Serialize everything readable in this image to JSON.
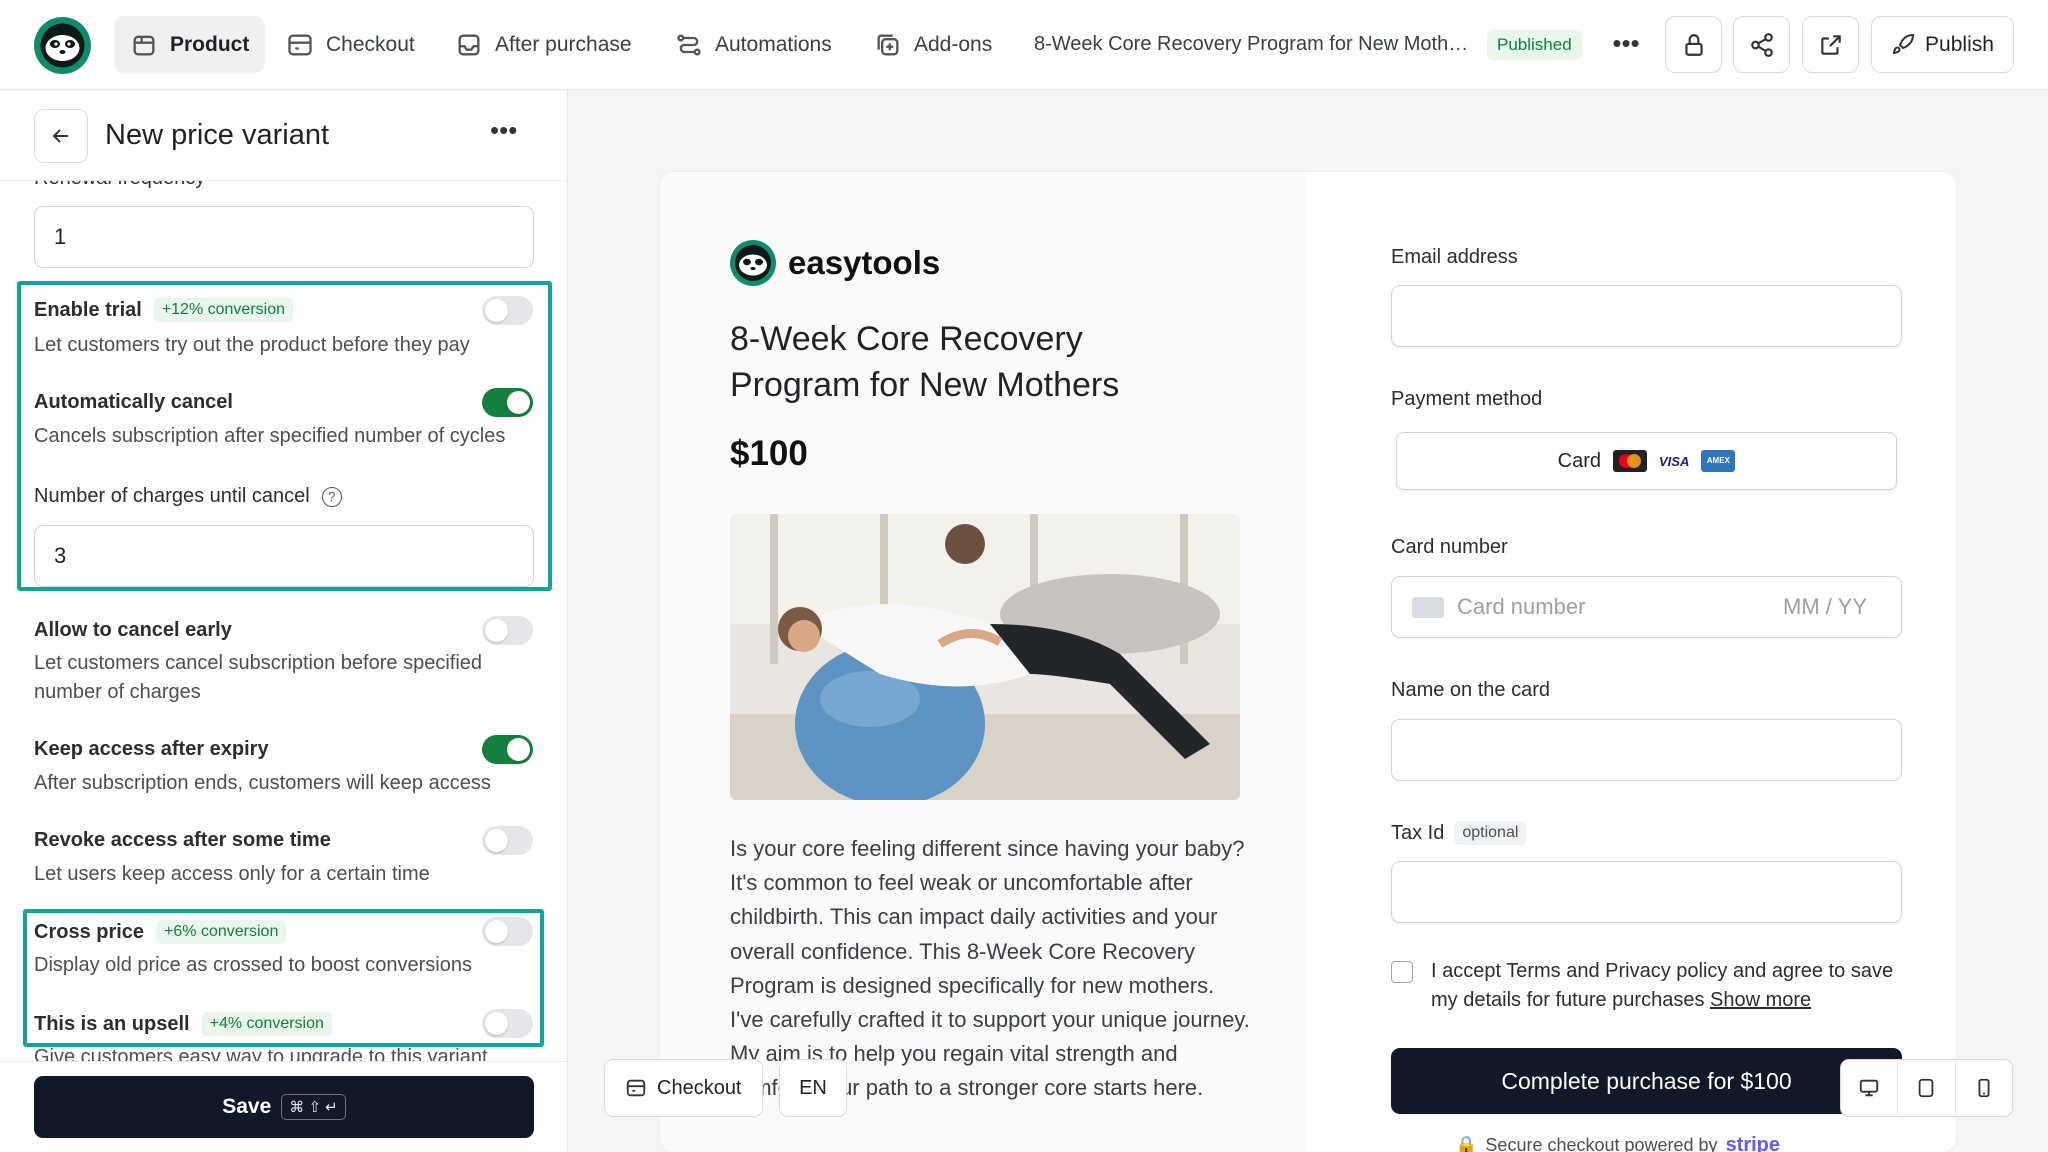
{
  "topbar": {
    "tabs": [
      {
        "label": "Product",
        "icon": "box-icon",
        "active": true
      },
      {
        "label": "Checkout",
        "icon": "checkout-icon",
        "active": false
      },
      {
        "label": "After purchase",
        "icon": "inbox-icon",
        "active": false
      },
      {
        "label": "Automations",
        "icon": "route-icon",
        "active": false
      },
      {
        "label": "Add-ons",
        "icon": "plus-square-icon",
        "active": false
      }
    ],
    "product_title": "8-Week Core Recovery Program for New Moth…",
    "status_badge": "Published",
    "more": "•••",
    "publish_label": "Publish"
  },
  "panel": {
    "title": "New price variant",
    "more": "•••",
    "clipped_label": "Renewal frequency",
    "renewal_value": "1",
    "options": [
      {
        "title": "Enable trial",
        "badge": "+12% conversion",
        "desc": "Let customers try out the product before they pay",
        "on": false
      },
      {
        "title": "Automatically cancel",
        "desc": "Cancels subscription after specified number of cycles",
        "on": true
      },
      {
        "title": "Allow to cancel early",
        "desc": "Let customers cancel subscription before specified number of charges",
        "on": false
      },
      {
        "title": "Keep access after expiry",
        "desc": "After subscription ends, customers will keep access",
        "on": true
      },
      {
        "title": "Revoke access after some time",
        "desc": "Let users keep access only for a certain time",
        "on": false
      },
      {
        "title": "Cross price",
        "badge": "+6% conversion",
        "desc": "Display old price as crossed to boost conversions",
        "on": false
      },
      {
        "title": "This is an upsell",
        "badge": "+4% conversion",
        "desc": "Give customers easy way to upgrade to this variant",
        "on": false
      }
    ],
    "charges_label": "Number of charges until cancel",
    "charges_value": "3",
    "help_glyph": "?",
    "save_label": "Save",
    "save_shortcut": "⌘ ⇧ ↵"
  },
  "preview": {
    "brand": "easytools",
    "title": "8-Week Core Recovery Program for New Mothers",
    "price": "$100",
    "description": "Is your core feeling different since having your baby? It's common to feel weak or uncomfortable after childbirth. This can impact daily activities and your overall confidence. This 8-Week Core Recovery Program is designed specifically for new mothers. I've carefully crafted it to support your unique journey. My aim is to help you regain vital strength and comfort. Your path to a stronger core starts here.",
    "form": {
      "email_label": "Email address",
      "payment_label": "Payment method",
      "payment_option": "Card",
      "visa_text": "VISA",
      "amex_text": "AMEX",
      "card_number_label": "Card number",
      "card_number_placeholder": "Card number",
      "expiry_placeholder": "MM / YY",
      "name_label": "Name on the card",
      "tax_label": "Tax Id",
      "tax_optional": "optional",
      "accept_text": "I accept Terms and Privacy policy and agree to save my details for future purchases",
      "show_more": "Show more",
      "complete_label": "Complete purchase for $100",
      "secure_text": "Secure checkout powered by",
      "secure_brand": "stripe"
    }
  },
  "floating": {
    "checkout_label": "Checkout",
    "language": "EN",
    "devices": [
      "desktop-icon",
      "tablet-icon",
      "mobile-icon"
    ]
  },
  "colors": {
    "accent_green": "#15803d",
    "highlight_teal": "#14a39a",
    "primary_dark": "#111827",
    "brand_green": "#0f8a6b",
    "stripe": "#635bff"
  }
}
